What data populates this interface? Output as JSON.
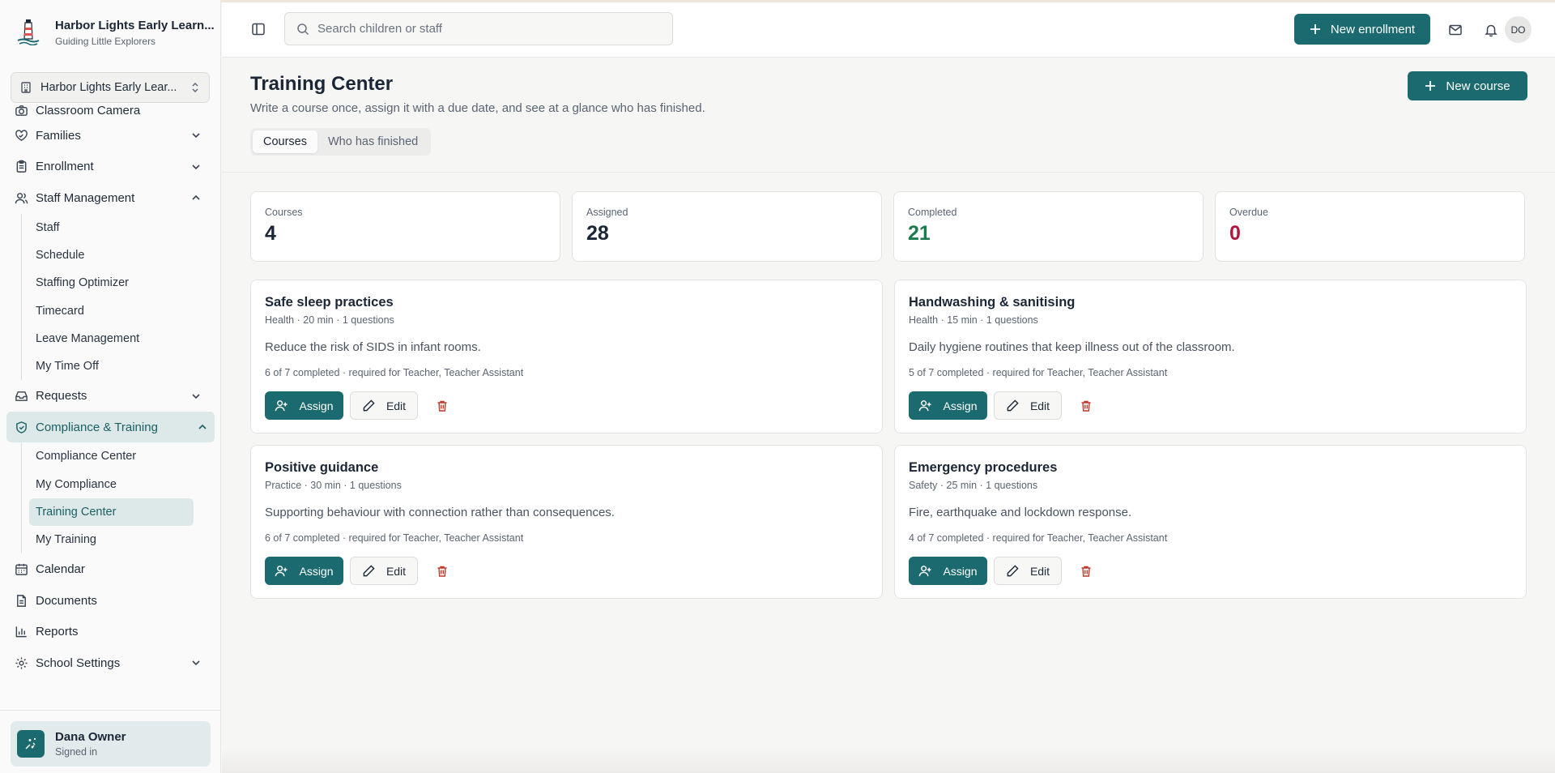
{
  "brand": {
    "name": "Harbor Lights Early Learn...",
    "tagline": "Guiding Little Explorers"
  },
  "org_select": {
    "value": "Harbor Lights Early Lear..."
  },
  "search": {
    "placeholder": "Search children or staff"
  },
  "topbar": {
    "new_enrollment_label": "New enrollment",
    "avatar_initials": "DO"
  },
  "nav": {
    "classroom_camera": "Classroom Camera",
    "families": "Families",
    "enrollment": "Enrollment",
    "staff_management": "Staff Management",
    "staff_sub": [
      "Staff",
      "Schedule",
      "Staffing Optimizer",
      "Timecard",
      "Leave Management",
      "My Time Off"
    ],
    "requests": "Requests",
    "compliance_training": "Compliance & Training",
    "compliance_sub": [
      "Compliance Center",
      "My Compliance",
      "Training Center",
      "My Training"
    ],
    "calendar": "Calendar",
    "documents": "Documents",
    "reports": "Reports",
    "school_settings": "School Settings"
  },
  "user": {
    "name": "Dana Owner",
    "status": "Signed in"
  },
  "page": {
    "title": "Training Center",
    "subtitle": "Write a course once, assign it with a due date, and see at a glance who has finished.",
    "new_course_label": "New course",
    "tabs": [
      "Courses",
      "Who has finished"
    ]
  },
  "stats": [
    {
      "label": "Courses",
      "value": "4"
    },
    {
      "label": "Assigned",
      "value": "28"
    },
    {
      "label": "Completed",
      "value": "21"
    },
    {
      "label": "Overdue",
      "value": "0"
    }
  ],
  "course_actions": {
    "assign": "Assign",
    "edit": "Edit"
  },
  "courses": [
    {
      "title": "Safe sleep practices",
      "meta": "Health · 20 min · 1 questions",
      "description": "Reduce the risk of SIDS in infant rooms.",
      "progress": "6 of 7 completed · required for Teacher, Teacher Assistant"
    },
    {
      "title": "Handwashing & sanitising",
      "meta": "Health · 15 min · 1 questions",
      "description": "Daily hygiene routines that keep illness out of the classroom.",
      "progress": "5 of 7 completed · required for Teacher, Teacher Assistant"
    },
    {
      "title": "Positive guidance",
      "meta": "Practice · 30 min · 1 questions",
      "description": "Supporting behaviour with connection rather than consequences.",
      "progress": "6 of 7 completed · required for Teacher, Teacher Assistant"
    },
    {
      "title": "Emergency procedures",
      "meta": "Safety · 25 min · 1 questions",
      "description": "Fire, earthquake and lockdown response.",
      "progress": "4 of 7 completed · required for Teacher, Teacher Assistant"
    }
  ],
  "colors": {
    "accent": "#1a6a6f",
    "completed": "#1c7a4f",
    "overdue": "#b01840",
    "trash": "#c0392b"
  }
}
